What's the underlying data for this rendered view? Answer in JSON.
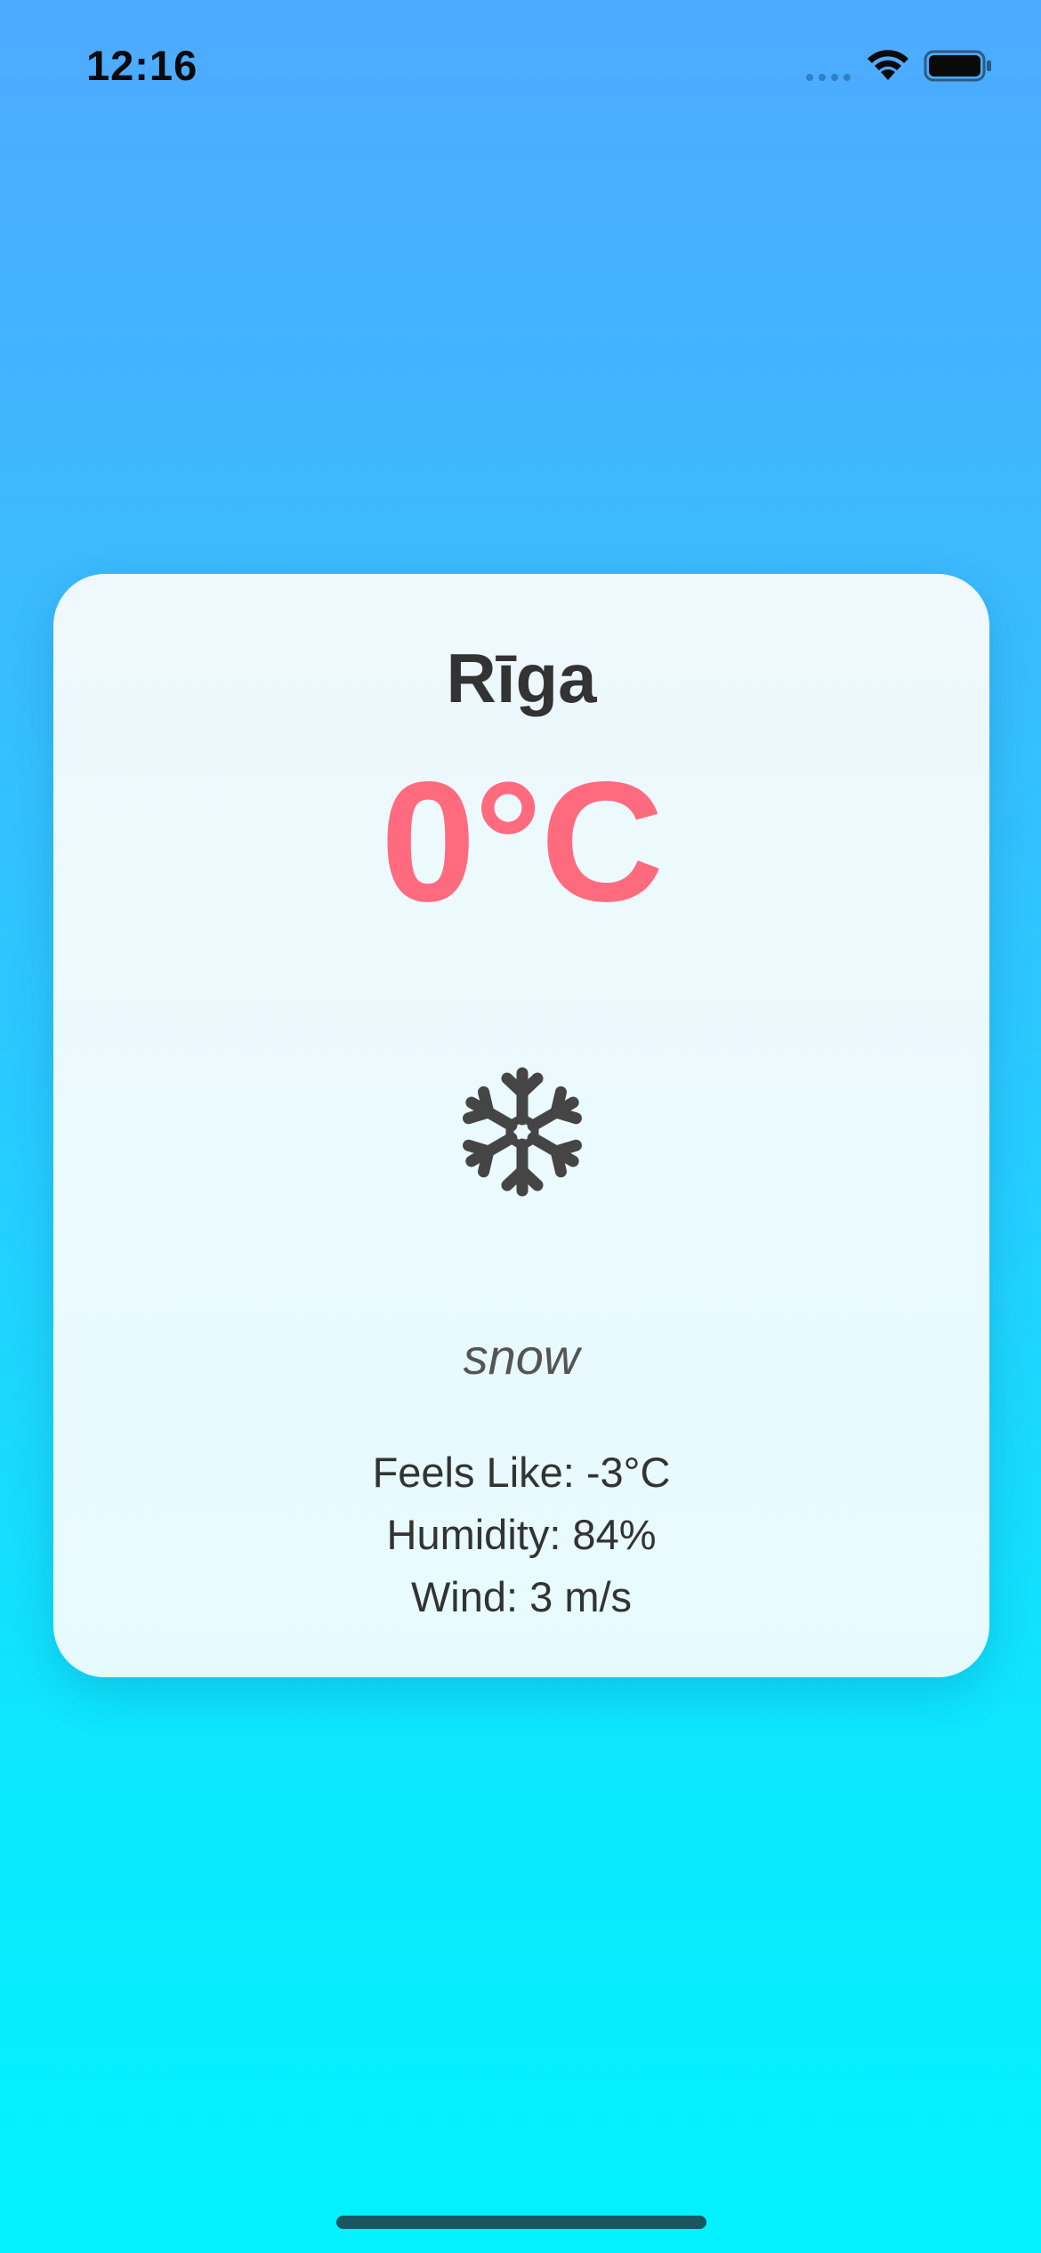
{
  "status_bar": {
    "time": "12:16",
    "signal_icon": "signal-dots-icon",
    "wifi_icon": "wifi-icon",
    "battery_icon": "battery-icon"
  },
  "weather": {
    "city": "Rīga",
    "temperature": "0°C",
    "condition_icon": "snowflake-icon",
    "description": "snow",
    "feels_like": "Feels Like: -3°C",
    "humidity": "Humidity: 84%",
    "wind": "Wind: 3 m/s"
  },
  "colors": {
    "background_top": "#4eaaff",
    "background_bottom": "#02f2ff",
    "card_background": "#eef8fd",
    "temperature_color": "#ff6b7e",
    "text_color": "#333333",
    "icon_color": "#454545"
  }
}
